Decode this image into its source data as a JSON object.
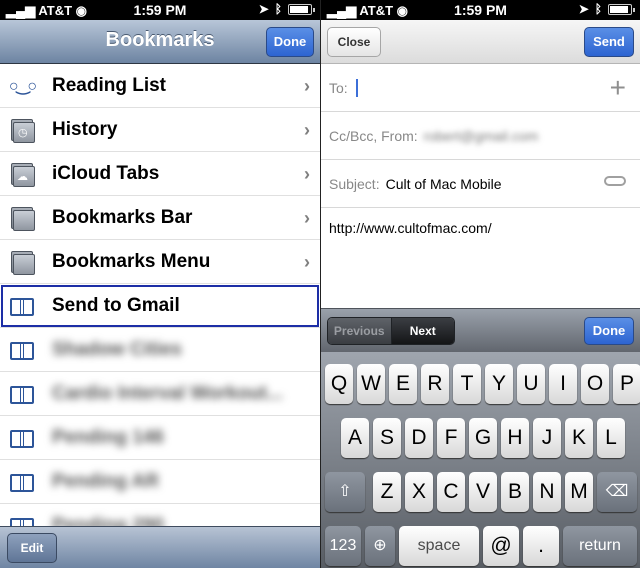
{
  "status_left": {
    "carrier": "AT&T",
    "time": "1:59 PM"
  },
  "status_right": {
    "carrier": "AT&T",
    "time": "1:59 PM"
  },
  "bookmarks": {
    "title": "Bookmarks",
    "done_label": "Done",
    "edit_label": "Edit",
    "items": [
      {
        "label": "Reading List",
        "icon": "reading-list-glasses-icon",
        "chevron": true
      },
      {
        "label": "History",
        "icon": "history-folder-icon",
        "chevron": true
      },
      {
        "label": "iCloud Tabs",
        "icon": "icloud-folder-icon",
        "chevron": true
      },
      {
        "label": "Bookmarks Bar",
        "icon": "folder-icon",
        "chevron": true
      },
      {
        "label": "Bookmarks Menu",
        "icon": "folder-icon",
        "chevron": true
      },
      {
        "label": "Send to Gmail",
        "icon": "book-icon",
        "chevron": false,
        "selected": true
      },
      {
        "label": "Shadow Cities",
        "icon": "book-icon",
        "blurred": true
      },
      {
        "label": "Cardio Interval Workout...",
        "icon": "book-icon",
        "blurred": true
      },
      {
        "label": "Pending 146",
        "icon": "book-icon",
        "blurred": true
      },
      {
        "label": "Pending AR",
        "icon": "book-icon",
        "blurred": true
      },
      {
        "label": "Pending 290",
        "icon": "book-icon",
        "blurred": true
      }
    ]
  },
  "compose": {
    "close_label": "Close",
    "send_label": "Send",
    "to_label": "To:",
    "ccbcc_label": "Cc/Bcc, From:",
    "from_value": "robert@gmail.com",
    "subject_label": "Subject:",
    "subject_value": "Cult of Mac Mobile",
    "body": "http://www.cultofmac.com/"
  },
  "keyboard": {
    "previous_label": "Previous",
    "next_label": "Next",
    "done_label": "Done",
    "row1": [
      "Q",
      "W",
      "E",
      "R",
      "T",
      "Y",
      "U",
      "I",
      "O",
      "P"
    ],
    "row2": [
      "A",
      "S",
      "D",
      "F",
      "G",
      "H",
      "J",
      "K",
      "L"
    ],
    "row3": [
      "Z",
      "X",
      "C",
      "V",
      "B",
      "N",
      "M"
    ],
    "numbers_label": "123",
    "space_label": "space",
    "at_label": "@",
    "dot_label": ".",
    "return_label": "return"
  },
  "colors": {
    "accent_blue": "#2d64d1",
    "selection_outline": "#1d2ea6"
  }
}
